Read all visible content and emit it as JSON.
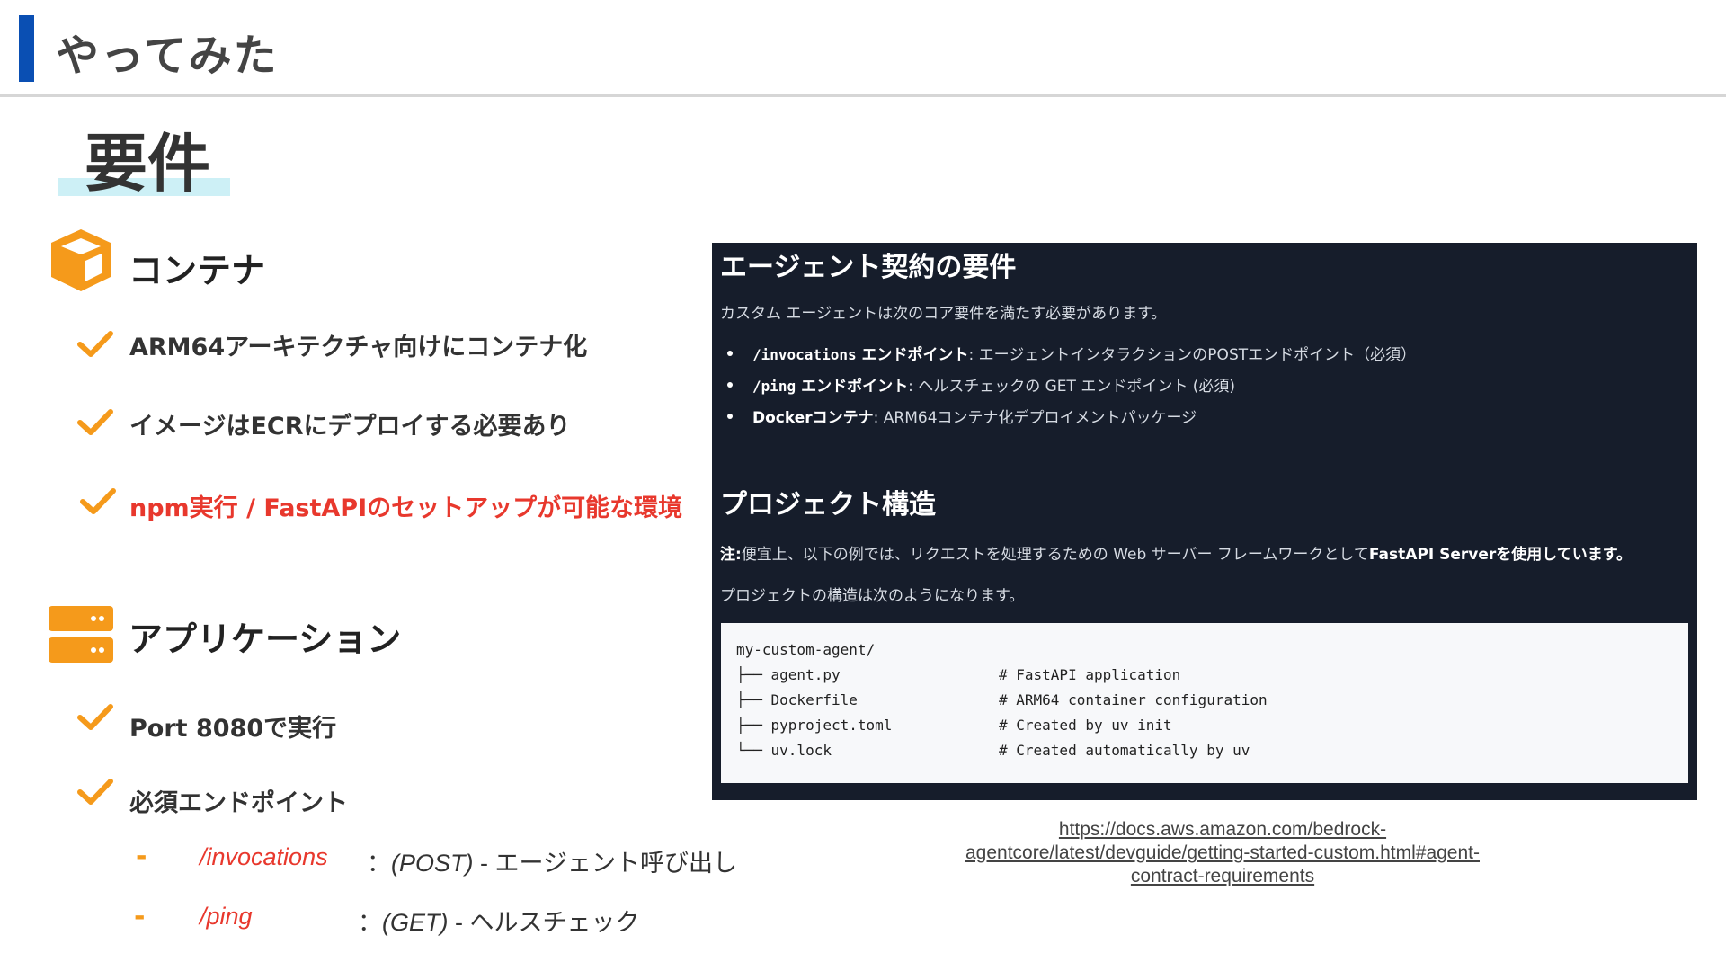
{
  "header": {
    "title": "やってみた"
  },
  "section": {
    "title": "要件"
  },
  "container": {
    "heading": "コンテナ",
    "items": [
      "ARM64アーキテクチャ向けにコンテナ化",
      "イメージはECRにデプロイする必要あり",
      "npm実行 / FastAPIのセットアップが可能な環境"
    ],
    "highlight_color": "#e8382d"
  },
  "application": {
    "heading": "アプリケーション",
    "items": [
      "Port 8080で実行",
      "必須エンドポイント"
    ],
    "endpoints": [
      {
        "dash": "-",
        "name": "/invocations",
        "sep": "：",
        "method": "(POST)",
        "desc": " - エージェント呼び出し"
      },
      {
        "dash": "-",
        "name": "/ping",
        "sep": "：",
        "method": "(GET)",
        "desc": " - ヘルスチェック"
      }
    ]
  },
  "screenshot": {
    "heading1": "エージェント契約の要件",
    "intro": "カスタム エージェントは次のコア要件を満たす必要があります。",
    "bullets": [
      {
        "code": "/invocations",
        "strong": " エンドポイント",
        "rest": ": エージェントインタラクションのPOSTエンドポイント（必須）"
      },
      {
        "code": "/ping",
        "strong": " エンドポイント",
        "rest": ": ヘルスチェックの GET エンドポイント (必須)"
      },
      {
        "code": "",
        "strong": "Dockerコンテナ",
        "rest": ": ARM64コンテナ化デプロイメントパッケージ"
      }
    ],
    "heading2": "プロジェクト構造",
    "note_label": "注:",
    "note_text": "便宜上、以下の例では、リクエストを処理するための Web サーバー フレームワークとして",
    "note_strong": "FastAPI Serverを使用しています。",
    "structure_intro": "プロジェクトの構造は次のようになります。",
    "code_lines": [
      {
        "text": "my-custom-agent/",
        "comment": ""
      },
      {
        "text": "├── agent.py",
        "comment": "# FastAPI application"
      },
      {
        "text": "├── Dockerfile",
        "comment": "# ARM64 container configuration"
      },
      {
        "text": "├── pyproject.toml",
        "comment": "# Created by uv init"
      },
      {
        "text": "└── uv.lock",
        "comment": "# Created automatically by uv"
      }
    ]
  },
  "source": {
    "line1": "https://docs.aws.amazon.com/bedrock-",
    "line2": "agentcore/latest/devguide/getting-started-custom.html#agent-",
    "line3": "contract-requirements"
  },
  "colors": {
    "accent_blue": "#0a4fb3",
    "orange": "#f59a1b",
    "red": "#e8382d",
    "panel_bg": "#161d2b",
    "code_comment": "#2e6fb8"
  },
  "icons": {
    "container": "box-icon",
    "application": "server-icon",
    "check": "checkmark-icon"
  }
}
